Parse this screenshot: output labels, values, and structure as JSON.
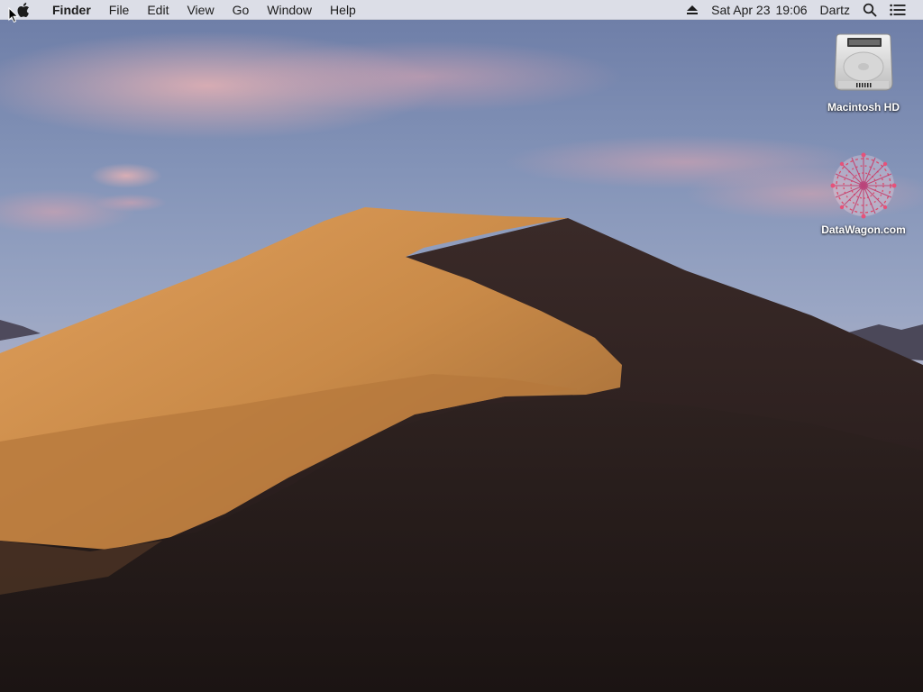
{
  "menubar": {
    "app_name": "Finder",
    "menus": [
      "File",
      "Edit",
      "View",
      "Go",
      "Window",
      "Help"
    ],
    "status": {
      "date": "Sat Apr 23",
      "time": "19:06",
      "user": "Dartz"
    },
    "icons": {
      "apple": "apple-logo-icon",
      "eject": "eject-icon",
      "spotlight": "spotlight-search-icon",
      "notification_center": "notification-center-icon"
    }
  },
  "desktop": {
    "wallpaper": "macOS Mojave day desert dunes",
    "icons": [
      {
        "label": "Macintosh HD",
        "icon": "hard-drive-icon"
      },
      {
        "label": "DataWagon.com",
        "icon": "network-volume-icon"
      }
    ]
  },
  "colors": {
    "menubar_bg": "#ECECF0",
    "menubar_text": "#1C1C1C",
    "sky_top": "#6F7FA8",
    "sky_horizon": "#B9B3C8",
    "dune_light": "#D08C45",
    "dune_shadow": "#2B1E1E",
    "icon_label": "#FFFFFF"
  }
}
